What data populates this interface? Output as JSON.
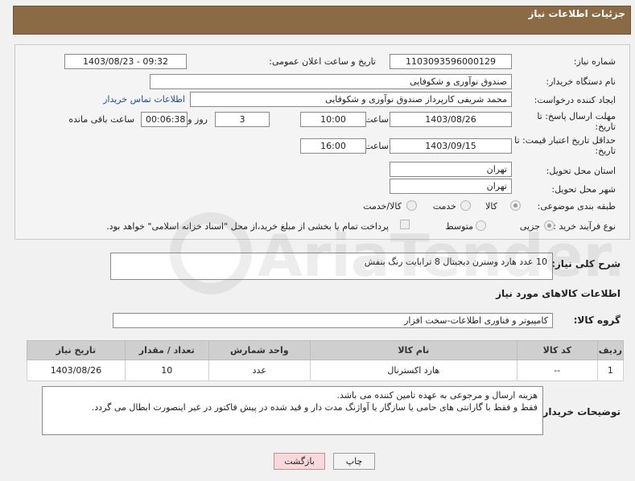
{
  "header": {
    "title": "جزئیات اطلاعات نیاز"
  },
  "form": {
    "need_number_label": "شماره نیاز:",
    "need_number": "1103093596000129",
    "announce_label": "تاریخ و ساعت اعلان عمومی:",
    "announce_value": "1403/08/23 - 09:32",
    "buyer_org_label": "نام دستگاه خریدار:",
    "buyer_org": "صندوق نوآوری و شکوفایی",
    "creator_label": "ایجاد کننده درخواست:",
    "creator": "محمد  شریفی کارپرداز صندوق نوآوری و شکوفایی",
    "contact_link": "اطلاعات تماس خریدار",
    "deadline_label_1": "مهلت ارسال پاسخ: تا",
    "deadline_label_2": "تاریخ:",
    "deadline_date": "1403/08/26",
    "time_label": "ساعت",
    "deadline_time": "10:00",
    "days_value": "3",
    "days_label": "روز و",
    "remaining_time": "00:06:38",
    "remaining_label": "ساعت باقی مانده",
    "validity_label_1": "حداقل تاریخ اعتبار قیمت: تا",
    "validity_label_2": "تاریخ:",
    "validity_date": "1403/09/15",
    "validity_time": "16:00",
    "province_label": "استان محل تحویل:",
    "province": "تهران",
    "city_label": "شهر محل تحویل:",
    "city": "تهران",
    "category_label": "طبقه بندی موضوعی:",
    "category_options": [
      "کالا",
      "خدمت",
      "کالا/خدمت"
    ],
    "process_label": "نوع فرآیند خرید :",
    "process_options": [
      "جزیی",
      "متوسط"
    ],
    "payment_note": "پرداخت تمام یا بخشی از مبلغ خرید،از محل \"اسناد خزانه اسلامی\" خواهد بود."
  },
  "description": {
    "label": "شرح کلی نیاز:",
    "text": "10 عدد هارد وسترن دیجیتال 8 ترابایت رنگ بنفش"
  },
  "goods_info": {
    "title": "اطلاعات کالاهای مورد نیاز",
    "group_label": "گروه کالا:",
    "group_value": "کامپیوتر و فناوری اطلاعات-سخت افزار"
  },
  "table": {
    "headers": [
      "ردیف",
      "کد کالا",
      "نام کالا",
      "واحد شمارش",
      "تعداد / مقدار",
      "تاریخ نیاز"
    ],
    "rows": [
      [
        "1",
        "--",
        "هارد اکسترنال",
        "عدد",
        "10",
        "1403/08/26"
      ]
    ]
  },
  "buyer_notes": {
    "label": "توضیحات خریدار:",
    "line1": "هزینه ارسال و مرجوعی به عهده تامین کننده می باشد.",
    "line2": "فقط و فقط با گارانتی های حامی یا سازگار یا آواژنگ مدت دار و قید شده در پیش فاکتور در غیر اینصورت ابطال می گردد."
  },
  "buttons": {
    "print": "چاپ",
    "back": "بازگشت"
  },
  "watermark": {
    "text": "AriaTender.neT"
  },
  "colors": {
    "header_bg": "#8b6b45",
    "link": "#1b4fa3",
    "back_button": "#f7d9dc"
  }
}
